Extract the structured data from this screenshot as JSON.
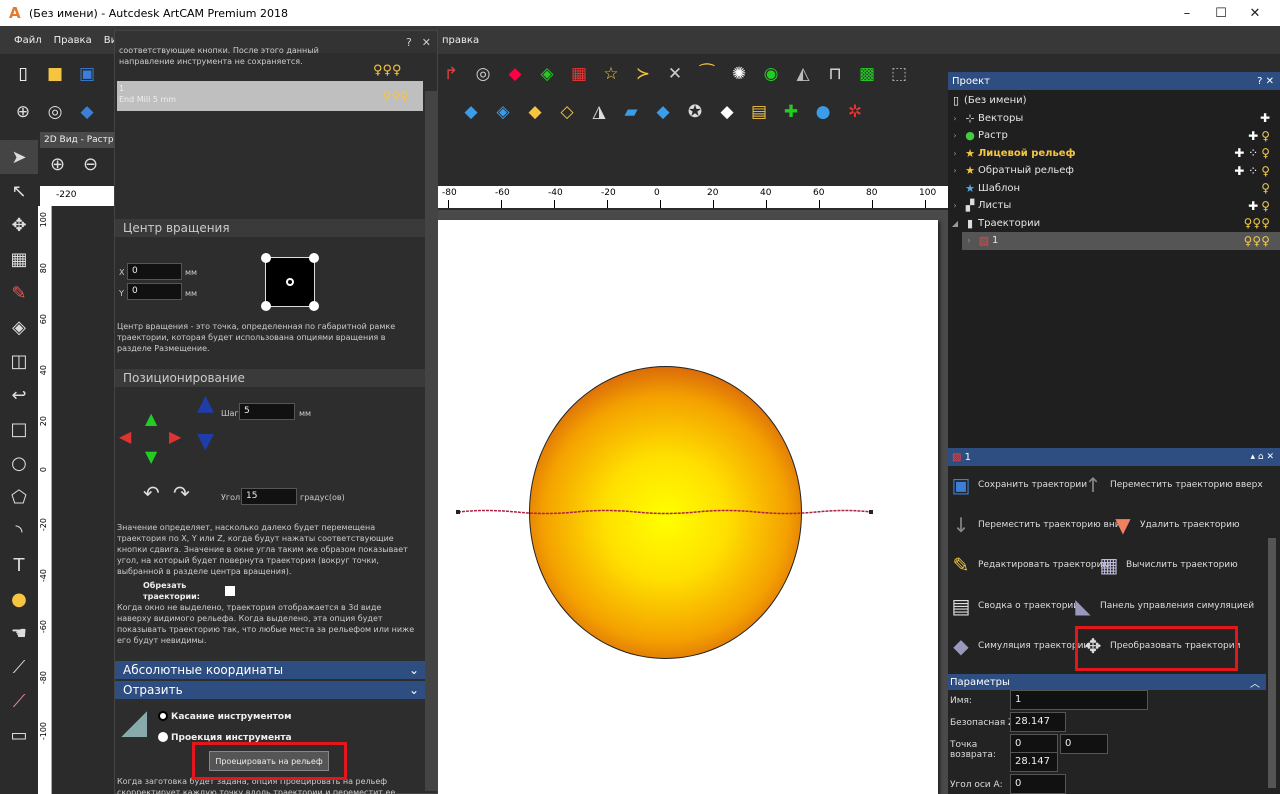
{
  "window": {
    "title": "(Без имени) - Autcdesk ArtCAM Premium 2018",
    "controls": [
      "–",
      "☐",
      "✕"
    ]
  },
  "menu": [
    "Файл",
    "Правка",
    "Вид",
    "правка"
  ],
  "view_tab": "2D Вид - Растр",
  "dock": {
    "top_text": "соответствующие кнопки. После этого данный направление инструмента не сохраняется.",
    "tool_number": "1",
    "tool_name": "End Mill 5 mm",
    "rotation_center": {
      "title": "Центр вращения",
      "x_label": "X",
      "x_value": "0",
      "x_unit": "мм",
      "y_label": "Y",
      "y_value": "0",
      "y_unit": "мм",
      "desc": "Центр вращения - это точка, определенная по габаритной рамке траектории, которая будет использована опциями вращения в разделе Размещение."
    },
    "positioning": {
      "title": "Позиционирование",
      "step_label": "Шаг",
      "step_value": "5",
      "step_unit": "мм",
      "angle_label": "Угол",
      "angle_value": "15",
      "angle_unit": "градус(ов)",
      "desc": "Значение определяет, насколько далеко будет перемещена траектория по X, Y или Z, когда будут нажаты соответствующие кнопки сдвига. Значение в окне угла таким же образом показывает угол, на который будет повернута траектория (вокруг точки, выбранной в разделе центра вращения).",
      "clip_label": "Обрезать траектории:",
      "clip_desc": "Когда окно не выделено, траектория отображается в 3d виде наверху видимого рельефа. Когда выделено, эта опция будет показывать траекторию так, что любые места за рельефом или ниже его будут невидимы."
    },
    "abs_coords": "Абсолютные координаты",
    "reflect": "Отразить",
    "radio1": "Касание инструментом",
    "radio2": "Проекция инструмента",
    "project_button": "Проецировать на рельеф",
    "bottom_text": "Когда заготовка будет задана, опция Проецировать на рельеф скорректирует каждую точку вдоль траектории и переместит ее"
  },
  "ruler_top": [
    "-220",
    "-80",
    "-60",
    "-40",
    "-20",
    "0",
    "20",
    "40",
    "60",
    "80",
    "100"
  ],
  "ruler_left": [
    "100",
    "80",
    "60",
    "40",
    "20",
    "0",
    "-20",
    "-40",
    "-60",
    "-80",
    "-100"
  ],
  "project": {
    "title": "Проект",
    "root": "(Без имени)",
    "items": [
      {
        "label": "Векторы",
        "icon": "vector-icon"
      },
      {
        "label": "Растр",
        "icon": "raster-icon"
      },
      {
        "label": "Лицевой рельеф",
        "icon": "star-icon"
      },
      {
        "label": "Обратный рельеф",
        "icon": "star-icon"
      },
      {
        "label": "Шаблон",
        "icon": "star-icon"
      },
      {
        "label": "Листы",
        "icon": "sheets-icon"
      },
      {
        "label": "Траектории",
        "icon": "toolpath-icon"
      },
      {
        "label": "1",
        "icon": "toolpath-icon"
      }
    ]
  },
  "toolpath_panel": {
    "title": "1",
    "actions": [
      "Сохранить траектории",
      "Переместить траекторию вверх",
      "Переместить траекторию вниз",
      "Удалить траекторию",
      "Редактировать траекторию",
      "Вычислить траекторию",
      "Сводка о траектории",
      "Панель управления симуляцией",
      "Симуляция траектории",
      "Преобразовать траектории"
    ],
    "params_title": "Параметры",
    "name_label": "Имя:",
    "name_value": "1",
    "safe_z_label": "Безопасная Z:",
    "safe_z_value": "28.147",
    "return_label": "Точка возврата:",
    "return_x": "0",
    "return_y": "0",
    "return_z": "28.147",
    "a_angle_label": "Угол оси А:",
    "a_angle_value": "0"
  },
  "colors": {
    "highlight": "#e3161b",
    "panel_head": "#2e4e82",
    "sphere_center": "#ffff00",
    "sphere_edge": "#8b1a1a"
  }
}
